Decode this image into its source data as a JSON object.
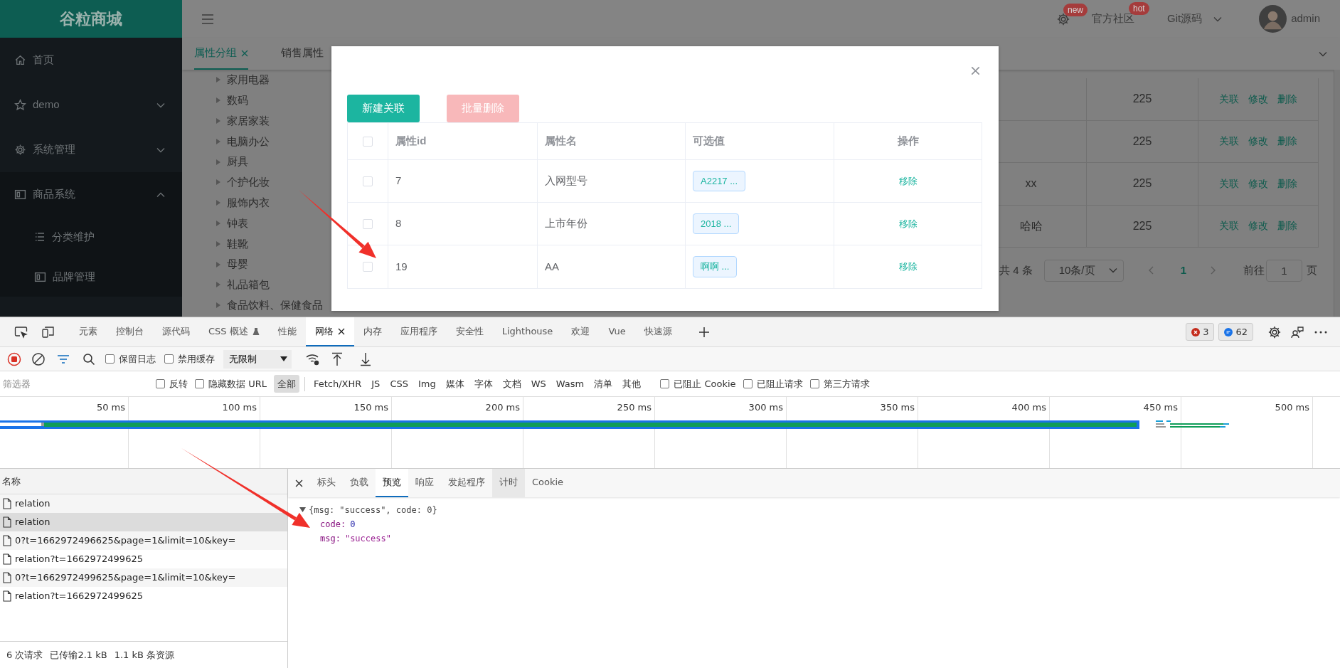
{
  "app": {
    "logo": "谷粒商城",
    "sidebar": {
      "items": [
        {
          "kind": "link",
          "label": "首页"
        },
        {
          "kind": "submenu",
          "label": "demo",
          "expanded": false
        },
        {
          "kind": "submenu",
          "label": "系统管理",
          "expanded": false
        },
        {
          "kind": "submenu",
          "label": "商品系统",
          "expanded": true,
          "children": [
            {
              "label": "分类维护"
            },
            {
              "label": "品牌管理"
            }
          ]
        }
      ]
    },
    "header": {
      "items": [
        {
          "kind": "settings",
          "badge": "new"
        },
        {
          "kind": "link",
          "label": "官方社区",
          "badge": "hot"
        },
        {
          "kind": "menu",
          "label": "Git源码"
        },
        {
          "kind": "user",
          "label": "admin"
        }
      ]
    },
    "page_tabs": [
      {
        "label": "属性分组",
        "selected": true
      },
      {
        "label": "销售属性",
        "selected": false
      }
    ],
    "category_tree": [
      {
        "label": "家用电器",
        "expanded": false
      },
      {
        "label": "数码",
        "expanded": false
      },
      {
        "label": "家居家装",
        "expanded": false
      },
      {
        "label": "电脑办公",
        "expanded": false
      },
      {
        "label": "厨具",
        "expanded": false
      },
      {
        "label": "个护化妆",
        "expanded": false
      },
      {
        "label": "服饰内衣",
        "expanded": false
      },
      {
        "label": "钟表",
        "expanded": false
      },
      {
        "label": "鞋靴",
        "expanded": false
      },
      {
        "label": "母婴",
        "expanded": false
      },
      {
        "label": "礼品箱包",
        "expanded": false
      },
      {
        "label": "食品饮料、保健食品",
        "expanded": false
      }
    ],
    "table": {
      "rows": [
        {
          "column_2": "225",
          "actions": [
            "关联",
            "修改",
            "删除"
          ]
        },
        {
          "column_2": "225",
          "actions": [
            "关联",
            "修改",
            "删除"
          ]
        },
        {
          "column_1": "xx",
          "column_2": "225",
          "actions": [
            "关联",
            "修改",
            "删除"
          ]
        },
        {
          "column_1": "哈哈",
          "column_2": "225",
          "actions": [
            "关联",
            "修改",
            "删除"
          ]
        }
      ]
    },
    "pagination": {
      "total": "共 4 条",
      "page_size": "10条/页",
      "pages": [
        {
          "label": "1",
          "selected": true
        }
      ],
      "goto_label": "前往",
      "goto_value": "1",
      "goto_suffix": "页"
    }
  },
  "dialog": {
    "buttons": [
      {
        "label": "新建关联",
        "disabled": false
      },
      {
        "label": "批量删除",
        "disabled": true
      }
    ],
    "table": {
      "select_all": false,
      "columns": [
        "属性id",
        "属性名",
        "可选值",
        "操作"
      ],
      "rows": [
        {
          "checked": false,
          "id": "7",
          "name": "入网型号",
          "values": "A2217 ...",
          "action": "移除"
        },
        {
          "checked": false,
          "id": "8",
          "name": "上市年份",
          "values": "2018 ...",
          "action": "移除"
        },
        {
          "checked": false,
          "id": "19",
          "name": "AA",
          "values": "啊啊 ...",
          "action": "移除"
        }
      ]
    }
  },
  "devtools": {
    "tabs": [
      {
        "label": "元素",
        "selected": false,
        "experimental": false,
        "closable": false
      },
      {
        "label": "控制台",
        "selected": false,
        "experimental": false,
        "closable": false
      },
      {
        "label": "源代码",
        "selected": false,
        "experimental": false,
        "closable": false
      },
      {
        "label": "CSS 概述",
        "selected": false,
        "experimental": true,
        "closable": false
      },
      {
        "label": "性能",
        "selected": false,
        "experimental": false,
        "closable": false
      },
      {
        "label": "网络",
        "selected": true,
        "experimental": false,
        "closable": true
      },
      {
        "label": "内存",
        "selected": false,
        "experimental": false,
        "closable": false
      },
      {
        "label": "应用程序",
        "selected": false,
        "experimental": false,
        "closable": false
      },
      {
        "label": "安全性",
        "selected": false,
        "experimental": false,
        "closable": false
      },
      {
        "label": "Lighthouse",
        "selected": false,
        "experimental": false,
        "closable": false
      },
      {
        "label": "欢迎",
        "selected": false,
        "experimental": false,
        "closable": false
      },
      {
        "label": "Vue",
        "selected": false,
        "experimental": false,
        "closable": false
      },
      {
        "label": "快速源",
        "selected": false,
        "experimental": false,
        "closable": false
      }
    ],
    "errors": "3",
    "messages": "62",
    "toolbar": {
      "recording": true,
      "checkboxes": [
        {
          "label": "保留日志",
          "checked": false
        },
        {
          "label": "禁用缓存",
          "checked": false
        }
      ],
      "throttle": "无限制"
    },
    "filter": {
      "placeholder": "筛选器",
      "checkboxes": [
        {
          "label": "反转",
          "checked": false
        },
        {
          "label": "隐藏数据 URL",
          "checked": false
        }
      ],
      "types": [
        {
          "label": "全部",
          "selected": true
        },
        {
          "label": "Fetch/XHR",
          "selected": false
        },
        {
          "label": "JS",
          "selected": false
        },
        {
          "label": "CSS",
          "selected": false
        },
        {
          "label": "Img",
          "selected": false
        },
        {
          "label": "媒体",
          "selected": false
        },
        {
          "label": "字体",
          "selected": false
        },
        {
          "label": "文档",
          "selected": false
        },
        {
          "label": "WS",
          "selected": false
        },
        {
          "label": "Wasm",
          "selected": false
        },
        {
          "label": "清单",
          "selected": false
        },
        {
          "label": "其他",
          "selected": false
        }
      ],
      "more_checkboxes": [
        {
          "label": "已阻止 Cookie",
          "checked": false
        },
        {
          "label": "已阻止请求",
          "checked": false
        },
        {
          "label": "第三方请求",
          "checked": false
        }
      ]
    },
    "timeline": {
      "ticks": [
        "50 ms",
        "100 ms",
        "150 ms",
        "200 ms",
        "250 ms",
        "300 ms",
        "350 ms",
        "400 ms",
        "450 ms",
        "500 ms"
      ]
    },
    "requests": {
      "header": "名称",
      "rows": [
        {
          "name": "relation",
          "selected": false
        },
        {
          "name": "relation",
          "selected": true
        },
        {
          "name": "0?t=1662972496625&page=1&limit=10&key=",
          "selected": false
        },
        {
          "name": "relation?t=1662972499625",
          "selected": false
        },
        {
          "name": "0?t=1662972499625&page=1&limit=10&key=",
          "selected": false
        },
        {
          "name": "relation?t=1662972499625",
          "selected": false
        }
      ]
    },
    "status": [
      "6 次请求",
      "已传输2.1 kB",
      "1.1 kB 条资源"
    ],
    "detail_tabs": [
      {
        "label": "标头",
        "selected": false,
        "hovered": false
      },
      {
        "label": "负载",
        "selected": false,
        "hovered": false
      },
      {
        "label": "预览",
        "selected": true,
        "hovered": false
      },
      {
        "label": "响应",
        "selected": false,
        "hovered": false
      },
      {
        "label": "发起程序",
        "selected": false,
        "hovered": false
      },
      {
        "label": "计时",
        "selected": false,
        "hovered": true
      },
      {
        "label": "Cookie",
        "selected": false,
        "hovered": false
      }
    ],
    "preview": {
      "summary": "{msg: \"success\", code: 0}",
      "expanded": true,
      "properties": [
        {
          "key": "code:",
          "value": "0",
          "kind": "number"
        },
        {
          "key": "msg:",
          "value": "\"success\"",
          "kind": "string"
        }
      ]
    }
  }
}
